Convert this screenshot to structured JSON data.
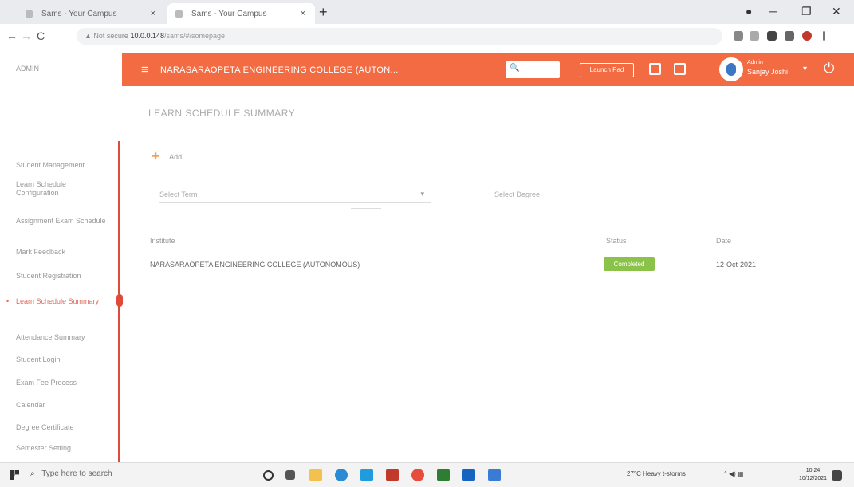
{
  "browser": {
    "tabs": [
      {
        "title": "Sams - Your Campus",
        "close": "×"
      },
      {
        "title": "Sams - Your Campus",
        "close": "×"
      }
    ],
    "new_tab": "+",
    "window_controls": [
      "●",
      "─",
      "❐",
      "✕"
    ],
    "nav": {
      "back": "←",
      "forward": "→",
      "reload": "C"
    },
    "url": {
      "security": "▲ Not secure",
      "host": "10.0.0.148",
      "path": "/sams/#/somepage"
    }
  },
  "sidebar": {
    "brand": "ADMIN",
    "items": [
      {
        "label": "Student Management",
        "active": false
      },
      {
        "label": "Learn Schedule Configuration",
        "active": false
      },
      {
        "label": "Assignment Exam Schedule",
        "active": false
      },
      {
        "label": "Mark Feedback",
        "active": false
      },
      {
        "label": "Student Registration",
        "active": false
      },
      {
        "label": "Learn Schedule Summary",
        "active": true
      },
      {
        "label": "Attendance Summary",
        "active": false
      },
      {
        "label": "Student Login",
        "active": false
      },
      {
        "label": "Exam Fee Process",
        "active": false
      },
      {
        "label": "Calendar",
        "active": false
      },
      {
        "label": "Degree Certificate",
        "active": false
      },
      {
        "label": "Semester Setting",
        "active": false
      }
    ]
  },
  "topbar": {
    "menu_icon": "≡",
    "college": "NARASARAOPETA ENGINEERING COLLEGE (AUTON...",
    "search_icon": "🔍",
    "launch_label": "Launch Pad",
    "role": "Admin",
    "user_name": "Sanjay Joshi",
    "caret": "▾",
    "power_icon": "⏻"
  },
  "page": {
    "title": "LEARN SCHEDULE SUMMARY",
    "add_icon": "✚",
    "add_label": "Add",
    "filter_placeholder": "Select Term",
    "filter_arrow": "▾",
    "filter_button": "Select Degree"
  },
  "table": {
    "headers": [
      "Institute",
      "Status",
      "Date"
    ],
    "rows": [
      {
        "institute": "NARASARAOPETA ENGINEERING COLLEGE (AUTONOMOUS)",
        "status": "Completed",
        "date": "12-Oct-2021"
      }
    ]
  },
  "taskbar": {
    "search_icon": "⌕",
    "search_placeholder": "Type here to search",
    "weather": "27°C  Heavy t-storms",
    "tray_icons": "^  ◀)  ▦",
    "time": "10:24",
    "date": "10/12/2021"
  },
  "colors": {
    "accent": "#f26b43",
    "sidebar_marker": "#e04a3a",
    "success": "#8bc34a"
  }
}
